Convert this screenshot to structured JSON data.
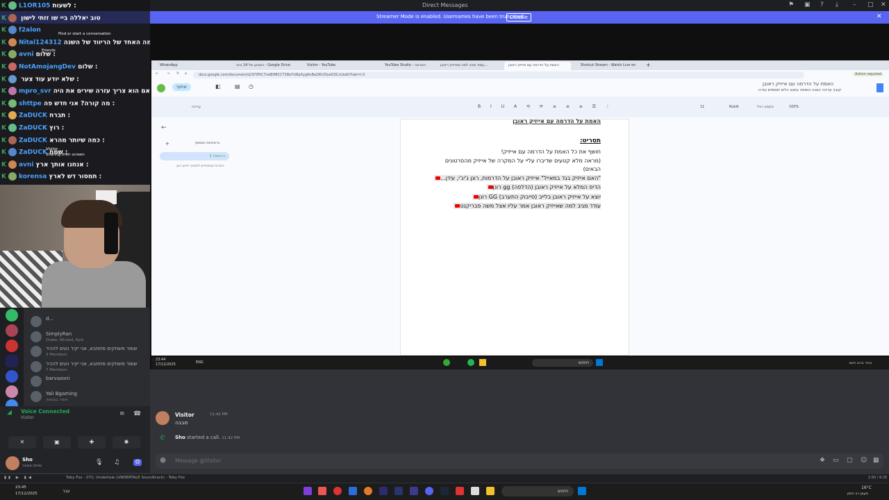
{
  "window": {
    "title": "Direct Messages"
  },
  "banner": {
    "text": "Streamer Mode is enabled. Usernames have been truncated.",
    "disable_label": "Disable"
  },
  "chat": [
    {
      "name": "L1OR105",
      "msg": "לשעות :"
    },
    {
      "name": "",
      "msg": "טוב יאללה ביי שו זזתי לישון"
    },
    {
      "name": "f2alon",
      "msg": ""
    },
    {
      "name": "Nital124312",
      "msg": "וכמה האחד של הריווד של השנה :"
    },
    {
      "name": "avni",
      "msg": "שלום :"
    },
    {
      "name": "NotAmojangDev",
      "msg": "שלום :"
    },
    {
      "name": "",
      "msg": "שלא יודע עוד צער :"
    },
    {
      "name": "mpro_svr",
      "msg": "אם הוא צריך עזרה שירים את היה :"
    },
    {
      "name": "shttpe",
      "msg": "מה קורה? אני חדש פה :"
    },
    {
      "name": "ZaDUCK",
      "msg": "תברח :"
    },
    {
      "name": "ZaDUCK",
      "msg": "רוץ :"
    },
    {
      "name": "ZaDUCK",
      "msg": "כמה שיותר מהרא :"
    },
    {
      "name": "ZaDUCK",
      "msg": "שמח :"
    },
    {
      "name": "avni",
      "msg": "אנחנו אותך ארץ :"
    },
    {
      "name": "korensa",
      "msg": "תמסור דש לארץ :"
    }
  ],
  "chat_overlay": {
    "find": "Find or start a conversation",
    "friends": "Friends",
    "library": "Library",
    "visitor": "Visitor",
    "sharing": "Sharing their screen"
  },
  "dm_list": [
    {
      "name": "d...",
      "sub": ""
    },
    {
      "name": "SimplyRan",
      "sub": "Drake, Wicked, Kyla"
    },
    {
      "name": "שומר משחקים מתחבא, אני יקיר נעים להכיר",
      "sub": "3 Members"
    },
    {
      "name": "שומר משחקים מתחבא, אני יקיר נעים להכיר",
      "sub": "7 Members"
    },
    {
      "name": "barvazoni",
      "sub": ""
    },
    {
      "name": "Yali Bgaming",
      "sub": "אומר בבנזאה"
    }
  ],
  "voice": {
    "status": "Voice Connected",
    "sub": "Visitor"
  },
  "user": {
    "name": "Sho",
    "status": "שיחת סאונד"
  },
  "browser": {
    "tabs": [
      "WhatsApp",
      "השבוע של 14 ביוני - Google Drive",
      "Visitor - YouTube",
      "",
      "YouTube Studio - השראה",
      "עמוד מניב למה שאייזיק ראובן...",
      "האמת על הדרמה עם אייזיק ראובן",
      "Shotcut Stream - Watch Live on"
    ],
    "url": "docs.google.com/document/d/1P3PtC7neBHBCCT1BeYUBp3ygAnBaQRU3lyeD3CxUedit?tab=t.0",
    "doc_title": "האמת על הדרמה עם אייזיק ראובן",
    "menu": "קובץ  עריכה  הצגה  הוספה  עיצוב  כלים  תוספים  עזרה",
    "share": "שיתוף",
    "action": "Action required",
    "zoom": "100%",
    "style": "טקסט רגיל",
    "font": "Rubik",
    "size": "11",
    "mode": "עריכה",
    "outline_title": "כרטיסיות המסמך",
    "outline_tab": "כרטיסיה 1",
    "outline_hint": "כותרות שמוסיפים למסמך יופיעו כאן."
  },
  "doc": {
    "top": "האמת על הדרמה עם אייזיק ראובן",
    "heading": "תסריט:",
    "l1": "חושף את כל האמת על הדרמה עם אייזיק!",
    "l2": "(מראה מלא קטעים שדיברו עליי על המקרה של אייזיק מהסרטונים",
    "l3": "הבאים)",
    "l4": "\"האם אייזיק בגד במאייל\" אייזיק ראובן על הדרמות, רונן ג'יג'י, עידן...",
    "l5": "הדיס המלא על אייזיק ראובן (הדלפה) gg רונן",
    "l6": "יוצא על אייזיק ראובן בלייב (סייבוק התערב) GG רונן",
    "l7": "עודד מגיב למה שאייזיק ראובן אמר עליו אצל משה פבריקנט"
  },
  "inner_taskbar": {
    "time": "23:44",
    "date": "17/12/2025",
    "lang": "ENG",
    "search": "חיפוש",
    "weather": "בהיר ברוב היום"
  },
  "message": {
    "author": "Visitor",
    "time": "11:42 PM",
    "text": "סבבה",
    "call_user": "Sho",
    "call_text": "started a call.",
    "call_time": "11:42 PM"
  },
  "input": {
    "placeholder": "Message @Visitor"
  },
  "media": {
    "track": "Toby Fox - 071: Undertale (UNDERTALE Soundtrack) - Toby Fox",
    "pos": "1:50 / 6:25"
  },
  "taskbar": {
    "time": "23:45",
    "date": "17/12/2025",
    "lang": "עבר",
    "search": "חיפוש",
    "weather": "16°C",
    "weather_sub": "מעונן רב הזמן"
  },
  "colors": {
    "accent": "#5865f2",
    "green": "#23a55a",
    "yt": "#ee0000"
  }
}
